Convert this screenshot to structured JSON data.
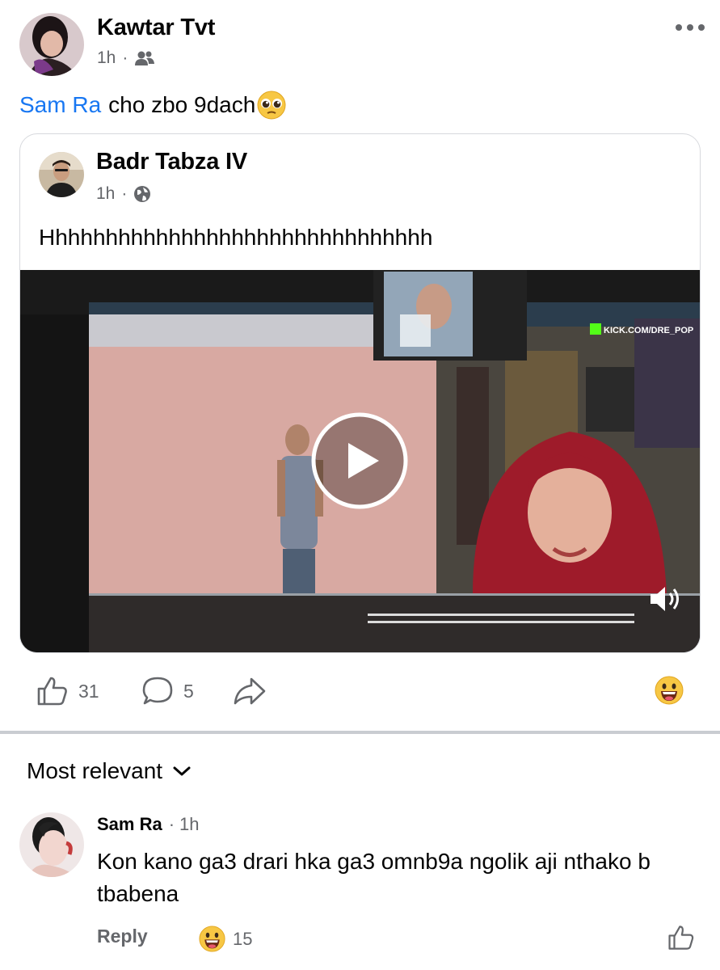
{
  "post": {
    "author": "Kawtar Tvt",
    "time": "1h",
    "audience_icon": "friends-icon",
    "mention": "Sam Ra",
    "text": "cho zbo 9dach",
    "emoji": "pleading-face-emoji"
  },
  "shared_post": {
    "author": "Badr Tabza IV",
    "time": "1h",
    "audience_icon": "globe-icon",
    "text": "Hhhhhhhhhhhhhhhhhhhhhhhhhhhhhhh",
    "video": {
      "watermark": "KICK.COM/DRE_POP",
      "play_icon": "play-icon",
      "volume_icon": "volume-icon"
    }
  },
  "actions": {
    "likes": "31",
    "comments": "5",
    "reaction_icon": "grinning-emoji"
  },
  "comments_section": {
    "sort_label": "Most relevant",
    "items": [
      {
        "author": "Sam Ra",
        "time": "1h",
        "text": "Kon kano ga3 drari hka ga3 omnb9a ngolik aji nthako b tbabena",
        "reply_label": "Reply",
        "reaction_count": "15"
      }
    ]
  },
  "colors": {
    "link": "#1877f2",
    "secondary_text": "#65676b",
    "divider": "#c9ccd1"
  }
}
